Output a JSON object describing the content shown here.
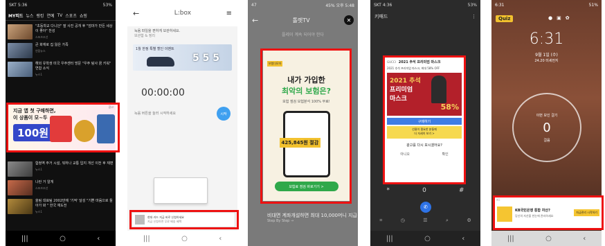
{
  "phone1": {
    "status": {
      "time": "SKT 5:36",
      "battery": "53%"
    },
    "tabs": [
      "MY피드",
      "뉴스",
      "랭킹",
      "연예",
      "TV",
      "스포츠",
      "쇼핑"
    ],
    "news": [
      {
        "title": "\"초등학교 다니던\" 딸 사진 공개 후 \"엄마가 만든 세상이 좋아\" 찬성",
        "source": "스포츠조선"
      },
      {
        "title": "큰 화재로 집 잃은 가족",
        "source": "연합뉴스"
      },
      {
        "title": "해외 유학생 미국 우주센터 방문 \"우주 탐사 꿈 키워\" 연합 소식",
        "source": "뉴스1"
      }
    ],
    "ad": {
      "line1": "지금 앱 첫 구매하면,",
      "line2": "이 상품이 모~두",
      "price": "100원",
      "badge": "광고"
    },
    "news2": [
      {
        "title": "합정역 주거 시설, 뭐하나 교통 입지 개선 이전 후 재편",
        "source": "뉴스1"
      },
      {
        "title": "나란 거 알게",
        "source": "스포츠조선"
      },
      {
        "title": "올림 대표팀 2002만에 '기적' 달성 \"기쁜 마음으로 돌아가 봐 \" 한국 재도전",
        "source": "뉴스1"
      }
    ]
  },
  "phone2": {
    "app_title": "L:box",
    "intro_text": "녹음 파일을 편하게 보관하세요.",
    "brand_line": "보관함 & 정리",
    "banner_text": "1월 한정 특별 할인 이벤트",
    "banner_numbers": "5 5 5",
    "timer": "00:00:00",
    "hint": "녹음 버튼을 눌러 시작하세요",
    "start_button": "시작",
    "bottom_ad_text": "현대 카드 지금 바로 신청하세요",
    "bottom_ad_sub": "지금 신청하면 무료 배송 혜택"
  },
  "phone3": {
    "status": {
      "time": "47",
      "battery": "45% 오후 5:48"
    },
    "header": "톨렛TV",
    "behind_text": "플레이 계속 되어야 한다",
    "ad": {
      "logo": "보험다모아",
      "headline1": "내가 가입한",
      "headline2": "최악의 보험은?",
      "sub": "보험 점검 보험분석 100% 무료!",
      "amount": "425,845원 절감",
      "cta": "보험료 점검 바로가기 >"
    },
    "bottom_text": "비대면 계좌개설하면 최대 10,000머니 지급",
    "bottom_sub": "Step By Step →"
  },
  "phone4": {
    "status": {
      "time": "SKT 4:36",
      "battery": "53%"
    },
    "app_title": "키패드",
    "ad": {
      "brand": "GUCCI",
      "title": "2021 추석 프리미엄 마스크",
      "desc": "2021 추석 프리미엄 마스크, 최대 58% OFF",
      "hero1": "2021 추석",
      "hero2": "프리미엄",
      "hero3": "마스크",
      "discount": "58%",
      "cta": "구매하기",
      "info": "선물이 필요한 분들께",
      "link": "더 자세히 보기 >",
      "close_q": "광고를 다시 보시겠어요?",
      "btn_left": "아니오",
      "btn_right": "확인"
    },
    "keypad": [
      "*",
      "0",
      "#"
    ]
  },
  "phone5": {
    "status": {
      "time": "6:31",
      "battery": "51%"
    },
    "quiz_label": "Quiz",
    "clock": "6:31",
    "date": "9월 1일 (수)",
    "weather": "24.20 미세먼지",
    "step_label": "이번 보인 걸기",
    "count": "0",
    "count_sub": "걸음",
    "ad": {
      "title": "KB국민은행 통합 자산?",
      "desc": "당신의 자산을 한눈에 관리하세요",
      "cta": "자금관리 시작하기",
      "badge": "광고"
    }
  }
}
